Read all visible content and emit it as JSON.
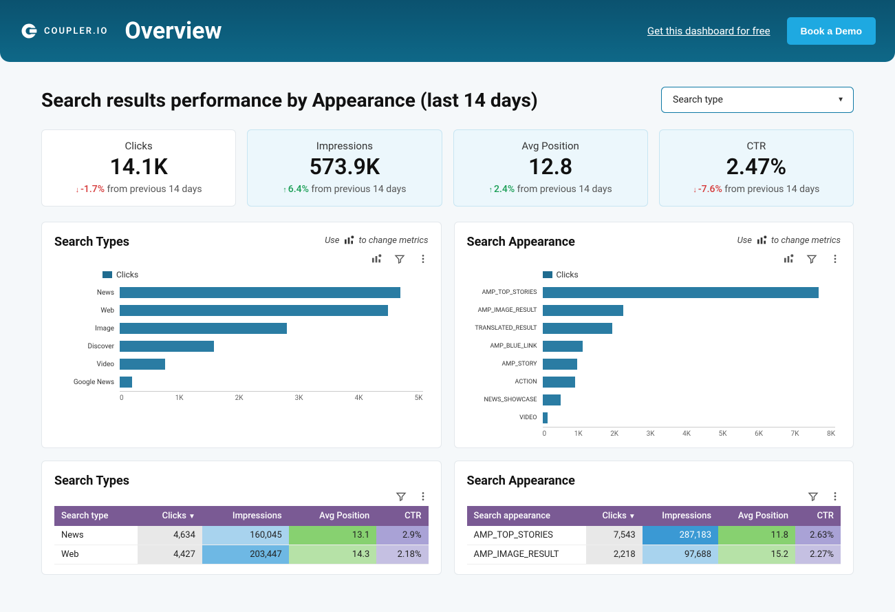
{
  "header": {
    "brand": "COUPLER.IO",
    "title": "Overview",
    "get_link": "Get this dashboard for free",
    "demo_btn": "Book a Demo"
  },
  "page_title": "Search results performance by Appearance (last 14 days)",
  "select": {
    "value": "Search type"
  },
  "metrics": {
    "clicks": {
      "label": "Clicks",
      "value": "14.1K",
      "delta": "-1.7%",
      "dir": "down",
      "suffix": "from previous 14 days"
    },
    "impressions": {
      "label": "Impressions",
      "value": "573.9K",
      "delta": "6.4%",
      "dir": "up",
      "suffix": "from previous 14 days"
    },
    "avg_pos": {
      "label": "Avg Position",
      "value": "12.8",
      "delta": "2.4%",
      "dir": "up",
      "suffix": "from previous 14 days"
    },
    "ctr": {
      "label": "CTR",
      "value": "2.47%",
      "delta": "-7.6%",
      "dir": "down",
      "suffix": "from previous 14 days"
    }
  },
  "panels": {
    "hint_use": "Use",
    "hint_suffix": "to change metrics",
    "types_title": "Search Types",
    "appearance_title": "Search Appearance",
    "legend_label": "Clicks"
  },
  "chart_data": [
    {
      "type": "bar",
      "orientation": "horizontal",
      "title": "Search Types",
      "legend": "Clicks",
      "x_ticks": [
        "0",
        "1K",
        "2K",
        "3K",
        "4K",
        "5K"
      ],
      "xlim": [
        0,
        5000
      ],
      "categories": [
        "News",
        "Web",
        "Image",
        "Discover",
        "Video",
        "Google News"
      ],
      "values": [
        4634,
        4427,
        2757,
        1550,
        750,
        200
      ]
    },
    {
      "type": "bar",
      "orientation": "horizontal",
      "title": "Search Appearance",
      "legend": "Clicks",
      "x_ticks": [
        "0",
        "1K",
        "2K",
        "3K",
        "4K",
        "5K",
        "6K",
        "7K",
        "8K"
      ],
      "xlim": [
        0,
        8000
      ],
      "categories": [
        "AMP_TOP_STORIES",
        "AMP_IMAGE_RESULT",
        "TRANSLATED_RESULT",
        "AMP_BLUE_LINK",
        "AMP_STORY",
        "ACTION",
        "NEWS_SHOWCASE",
        "VIDEO"
      ],
      "values": [
        7543,
        2218,
        1900,
        1100,
        950,
        900,
        500,
        150
      ]
    }
  ],
  "tables": {
    "types": {
      "title": "Search Types",
      "headers": {
        "c0": "Search type",
        "c1": "Clicks",
        "c2": "Impressions",
        "c3": "Avg Position",
        "c4": "CTR"
      },
      "rows": [
        {
          "c0": "News",
          "c1": "4,634",
          "c2": "160,045",
          "c3": "13.1",
          "c4": "2.9%"
        },
        {
          "c0": "Web",
          "c1": "4,427",
          "c2": "203,447",
          "c3": "14.3",
          "c4": "2.18%"
        }
      ]
    },
    "appearance": {
      "title": "Search Appearance",
      "headers": {
        "c0": "Search appearance",
        "c1": "Clicks",
        "c2": "Impressions",
        "c3": "Avg Position",
        "c4": "CTR"
      },
      "rows": [
        {
          "c0": "AMP_TOP_STORIES",
          "c1": "7,543",
          "c2": "287,183",
          "c3": "11.8",
          "c4": "2.63%"
        },
        {
          "c0": "AMP_IMAGE_RESULT",
          "c1": "2,218",
          "c2": "97,688",
          "c3": "15.2",
          "c4": "2.27%"
        }
      ]
    }
  }
}
